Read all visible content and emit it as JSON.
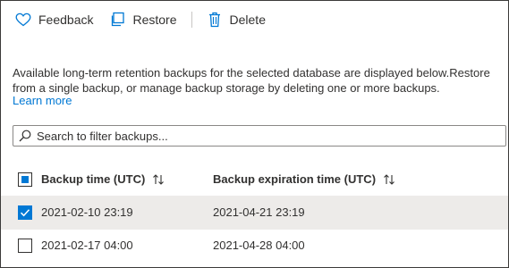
{
  "toolbar": {
    "feedback_label": "Feedback",
    "restore_label": "Restore",
    "delete_label": "Delete"
  },
  "description": "Available long-term retention backups for the selected database are displayed below.Restore from a single backup, or manage backup storage by deleting one or more backups.",
  "learn_more": "Learn more",
  "search": {
    "placeholder": "Search to filter backups..."
  },
  "table": {
    "headers": [
      "Backup time (UTC)",
      "Backup expiration time (UTC)"
    ],
    "rows": [
      {
        "backup_time": "2021-02-10 23:19",
        "expiration_time": "2021-04-21 23:19",
        "selected": true
      },
      {
        "backup_time": "2021-02-17 04:00",
        "expiration_time": "2021-04-28 04:00",
        "selected": false
      }
    ]
  },
  "colors": {
    "accent": "#0078d4",
    "text": "#323130",
    "selected_row": "#edebe9"
  }
}
